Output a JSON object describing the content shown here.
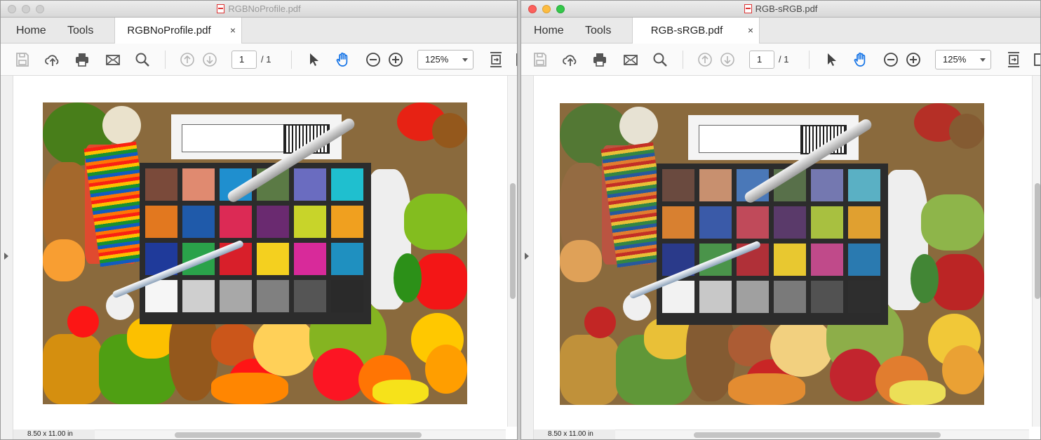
{
  "windows": [
    {
      "id": "left",
      "title": "RGBNoProfile.pdf",
      "active": false,
      "nav": {
        "home": "Home",
        "tools": "Tools"
      },
      "tab": {
        "label": "RGBNoProfile.pdf",
        "close": "×"
      },
      "page": {
        "current": "1",
        "total": "/ 1"
      },
      "zoom": "125%",
      "page_size": "8.50 x 11.00 in"
    },
    {
      "id": "right",
      "title": "RGB-sRGB.pdf",
      "active": true,
      "nav": {
        "home": "Home",
        "tools": "Tools"
      },
      "tab": {
        "label": "RGB-sRGB.pdf",
        "close": "×"
      },
      "page": {
        "current": "1",
        "total": "/ 1"
      },
      "zoom": "125%",
      "page_size": "8.50 x 11.00 in"
    }
  ],
  "toolbar_icons": [
    "save-icon",
    "upload-icon",
    "print-icon",
    "email-icon",
    "search-icon",
    "page-up-icon",
    "page-down-icon",
    "select-cursor-icon",
    "hand-tool-icon",
    "zoom-out-icon",
    "zoom-in-icon",
    "fit-page-icon"
  ],
  "colors": {
    "accent_blue": "#1473e6",
    "checker_no_profile": [
      "#7a4a3a",
      "#e08a70",
      "#1f8fcf",
      "#5b7a45",
      "#6a6cc0",
      "#1fbfcf",
      "#e2781f",
      "#1f5aaa",
      "#dc2a55",
      "#6a2a70",
      "#c8d42a",
      "#f0a01f",
      "#1f3a9a",
      "#2aa24a",
      "#d81f2a",
      "#f4d01f",
      "#d82a9a",
      "#1f90c0",
      "#f6f6f6",
      "#cfcfcf",
      "#a8a8a8",
      "#808080",
      "#555555",
      "#2a2a2a"
    ],
    "checker_srgb": [
      "#6a4a3f",
      "#c8906f",
      "#4a78b8",
      "#58704a",
      "#7478b0",
      "#5ab0c4",
      "#d88030",
      "#3a5aa8",
      "#c04a5a",
      "#5a3a6a",
      "#a8c040",
      "#e0a030",
      "#2a3a8a",
      "#4a944a",
      "#b03038",
      "#e8c830",
      "#c04a8a",
      "#2a7ab0",
      "#f2f2f2",
      "#c8c8c8",
      "#a0a0a0",
      "#7a7a7a",
      "#525252",
      "#2e2e2e"
    ]
  }
}
